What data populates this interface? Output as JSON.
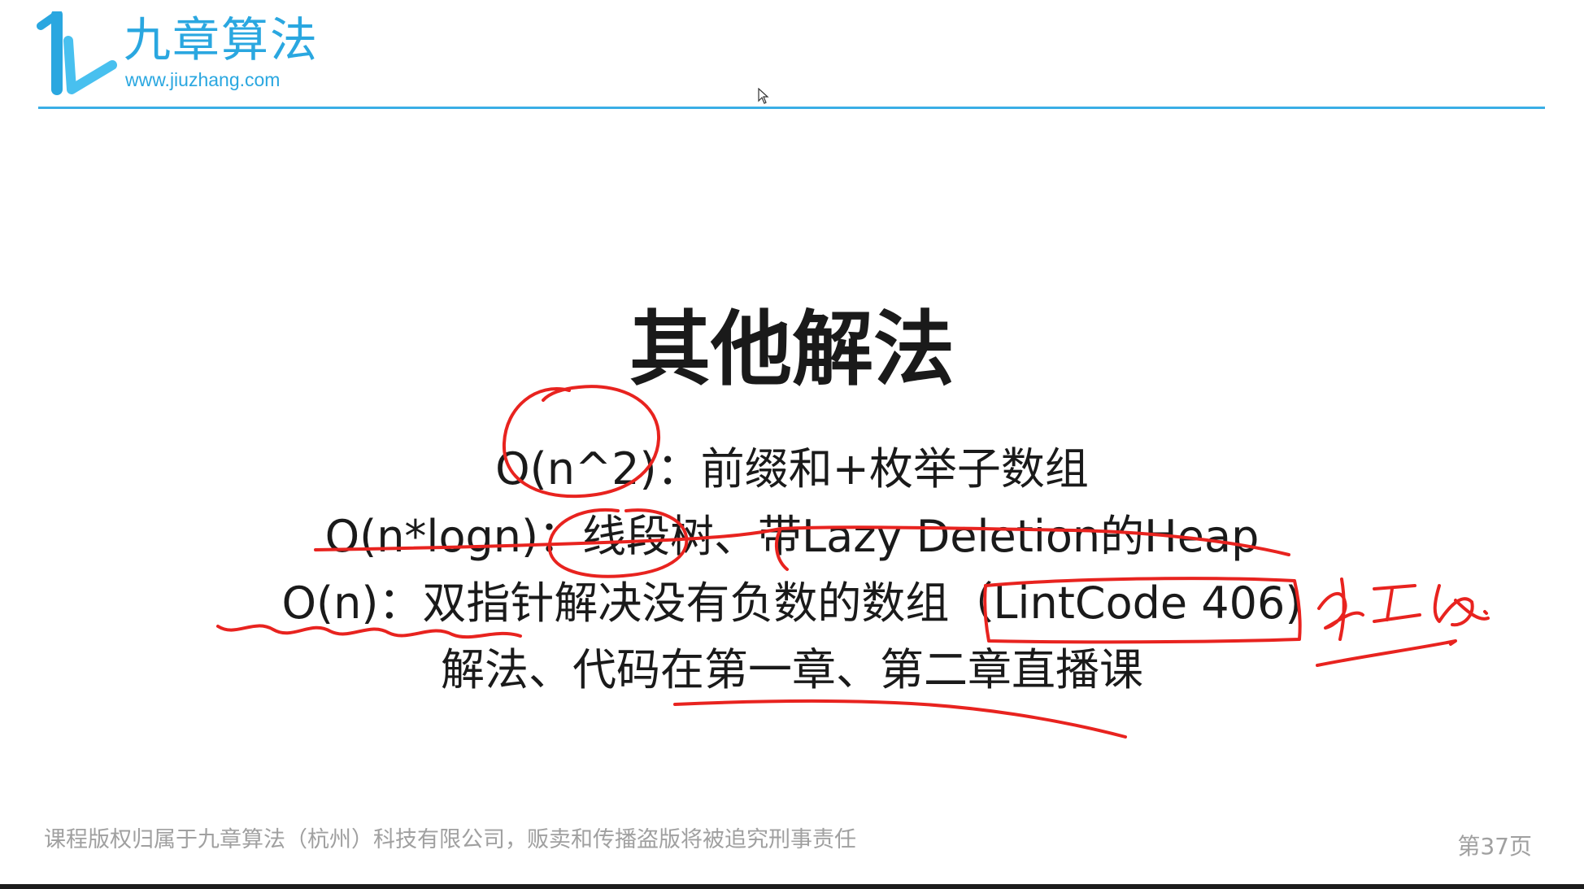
{
  "header": {
    "logo_icon": "jiuzhang-logo-icon",
    "logo_text": "九章算法",
    "logo_url": "www.jiuzhang.com"
  },
  "slide": {
    "title": "其他解法",
    "lines": [
      "O(n^2)：前缀和+枚举子数组",
      "O(n*logn)：线段树、带Lazy Deletion的Heap",
      "O(n)：双指针解决没有负数的数组（LintCode 406)",
      "解法、代码在第一章、第二章直播课"
    ]
  },
  "footer": {
    "copyright": "课程版权归属于九章算法（杭州）科技有限公司，贩卖和传播盗版将被追究刑事责任",
    "page": "第37页"
  },
  "colors": {
    "brand": "#2aa7e0",
    "rule": "#3aaee6",
    "text": "#1a1a1a",
    "footer_text": "#a0a0a0",
    "ink": "#e8231f"
  },
  "icons": {
    "cursor": "mouse-pointer-icon"
  }
}
